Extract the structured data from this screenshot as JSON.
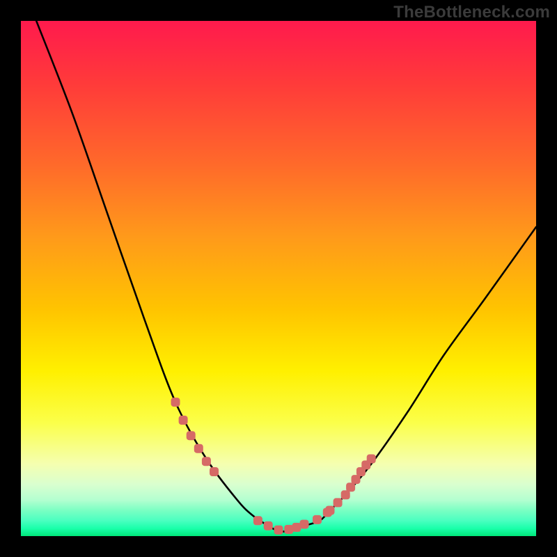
{
  "watermark": "TheBottleneck.com",
  "chart_data": {
    "type": "line",
    "title": "",
    "xlabel": "",
    "ylabel": "",
    "xlim": [
      0,
      100
    ],
    "ylim": [
      0,
      100
    ],
    "series": [
      {
        "name": "curve",
        "x": [
          3,
          10,
          17,
          24,
          30,
          36,
          42,
          45,
          48,
          50,
          52,
          55,
          58,
          60,
          63,
          68,
          75,
          82,
          90,
          100
        ],
        "y": [
          100,
          82,
          62,
          42,
          26,
          15,
          7,
          4,
          2,
          1,
          1,
          2,
          3,
          5,
          8,
          14,
          24,
          35,
          46,
          60
        ]
      }
    ],
    "markers": {
      "name": "highlighted-points",
      "color": "#d66a66",
      "x": [
        30,
        31.5,
        33,
        34.5,
        36,
        37.5,
        46,
        48,
        50,
        52,
        53.5,
        55,
        57.5,
        59.5,
        60,
        61.5,
        63,
        64,
        65,
        66,
        67,
        68
      ],
      "y": [
        26,
        22.5,
        19.5,
        17,
        14.5,
        12.5,
        3,
        2,
        1.2,
        1.3,
        1.7,
        2.3,
        3.2,
        4.6,
        5,
        6.5,
        8,
        9.5,
        11,
        12.5,
        13.8,
        15
      ]
    },
    "background_gradient": {
      "top": "#ff1a4d",
      "mid": "#fff000",
      "bottom": "#00e67a"
    }
  }
}
